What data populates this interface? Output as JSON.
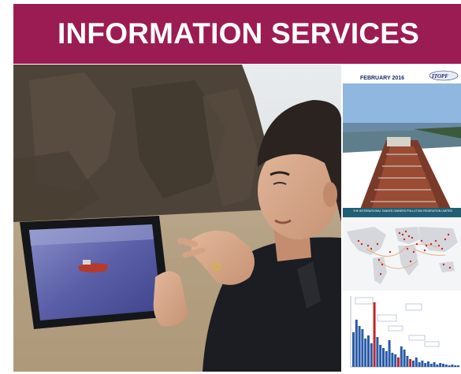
{
  "banner": {
    "title": "INFORMATION SERVICES"
  },
  "newsletter": {
    "date": "FEBRUARY 2016",
    "logo": "ITOPF",
    "footer": "THE INTERNATIONAL TANKER OWNERS POLLUTION FEDERATION LIMITED"
  },
  "colors": {
    "banner": "#9b1c52",
    "banner_text": "#ffffff",
    "chart_bars": "#2a5ca8",
    "chart_highlight": "#c0262d",
    "map_markers": "#d8231b"
  }
}
